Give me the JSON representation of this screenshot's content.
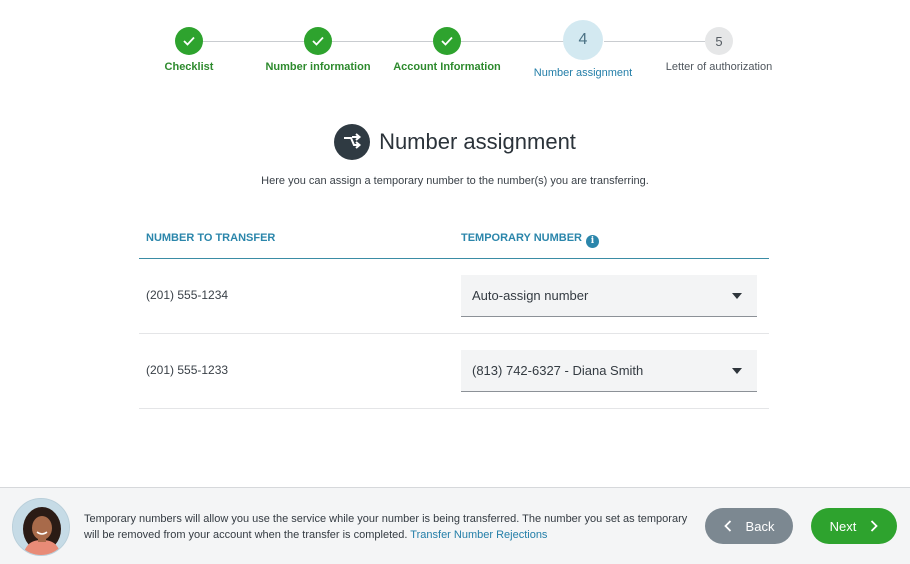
{
  "stepper": {
    "steps": [
      {
        "label": "Checklist",
        "state": "done",
        "marker": "✓"
      },
      {
        "label": "Number information",
        "state": "done",
        "marker": "✓"
      },
      {
        "label": "Account Information",
        "state": "done",
        "marker": "✓"
      },
      {
        "label": "Number assignment",
        "state": "current",
        "marker": "4"
      },
      {
        "label": "Letter of authorization",
        "state": "todo",
        "marker": "5"
      }
    ]
  },
  "page": {
    "icon": "transfer-arrows-icon",
    "title": "Number assignment",
    "subtitle": "Here you can assign a temporary number to the number(s) you are transferring."
  },
  "table": {
    "headers": {
      "number_to_transfer": "NUMBER TO TRANSFER",
      "temporary_number": "TEMPORARY NUMBER",
      "info_glyph": "i"
    },
    "rows": [
      {
        "number": "(201) 555-1234",
        "temporary": "Auto-assign number"
      },
      {
        "number": "(201) 555-1233",
        "temporary": "(813) 742-6327 - Diana Smith"
      }
    ]
  },
  "footer": {
    "message": "Temporary numbers will allow you use the service while your number is being transferred. The number you set as temporary will be removed from your account when the transfer is completed.",
    "link": "Transfer Number Rejections",
    "back_label": "Back",
    "next_label": "Next"
  },
  "colors": {
    "success": "#2ea32e",
    "accent": "#237ea8",
    "current_step_bg": "#d3e9f1",
    "back_button": "#7c8891"
  }
}
